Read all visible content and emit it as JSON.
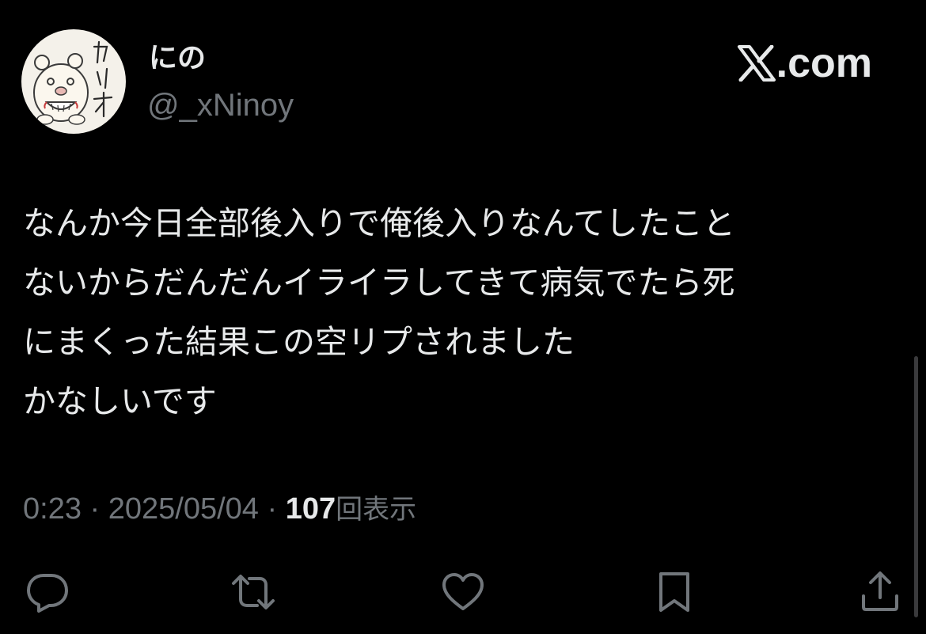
{
  "author": {
    "display_name": "にの",
    "handle": "@_xNinoy",
    "avatar_text": "カリオ"
  },
  "brand": {
    "label": ".com",
    "icon": "x-logo-icon"
  },
  "tweet": {
    "lines": [
      "なんか今日全部後入りで俺後入りなんてしたこと",
      "ないからだんだんイライラしてきて病気でたら死",
      "にまくった結果この空リプされました",
      "かなしいです"
    ]
  },
  "meta": {
    "time": "0:23",
    "separator": " · ",
    "date": "2025/05/04",
    "views": "107",
    "views_label": "回表示"
  },
  "actions": [
    {
      "name": "reply",
      "icon": "speech-bubble-icon"
    },
    {
      "name": "repost",
      "icon": "repost-arrows-icon"
    },
    {
      "name": "like",
      "icon": "heart-icon"
    },
    {
      "name": "bookmark",
      "icon": "bookmark-icon"
    },
    {
      "name": "share",
      "icon": "share-upload-icon"
    }
  ],
  "colors": {
    "background": "#000000",
    "primary_text": "#e7e9ea",
    "secondary_text": "#71767b"
  }
}
